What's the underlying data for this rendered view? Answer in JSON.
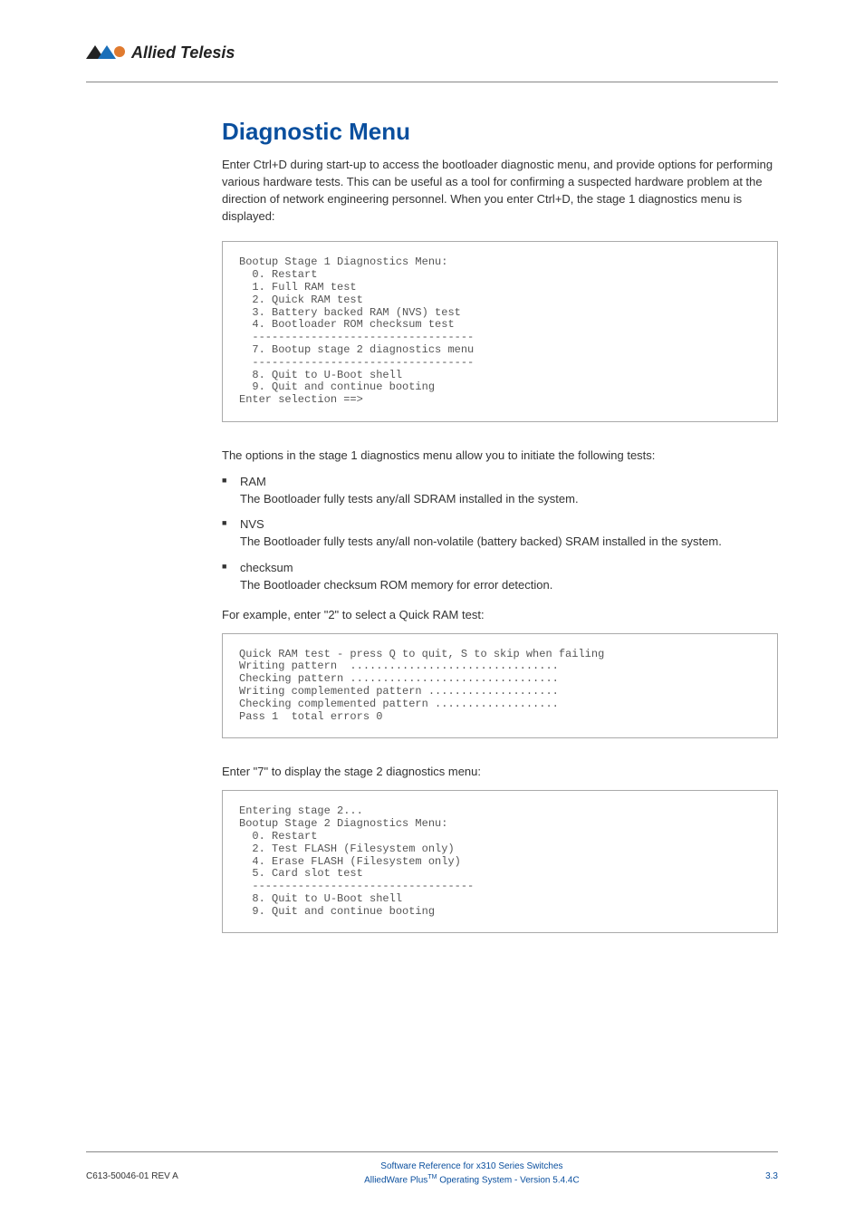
{
  "chart_data": {
    "type": "table",
    "title": "Diagnostic Menu",
    "description": "Bootloader diagnostic menu options and test output",
    "stage1_menu_options": [
      {
        "option": 0,
        "label": "Restart"
      },
      {
        "option": 1,
        "label": "Full RAM test"
      },
      {
        "option": 2,
        "label": "Quick RAM test"
      },
      {
        "option": 3,
        "label": "Battery backed RAM (NVS) test"
      },
      {
        "option": 4,
        "label": "Bootloader ROM checksum test"
      },
      {
        "option": 7,
        "label": "Bootup stage 2 diagnostics menu"
      },
      {
        "option": 8,
        "label": "Quit to U-Boot shell"
      },
      {
        "option": 9,
        "label": "Quit and continue booting"
      }
    ],
    "stage2_menu_options": [
      {
        "option": 0,
        "label": "Restart"
      },
      {
        "option": 2,
        "label": "Test FLASH (Filesystem only)"
      },
      {
        "option": 4,
        "label": "Erase FLASH (Filesystem only)"
      },
      {
        "option": 5,
        "label": "Card slot test"
      },
      {
        "option": 8,
        "label": "Quit to U-Boot shell"
      },
      {
        "option": 9,
        "label": "Quit and continue booting"
      }
    ],
    "quick_ram_test_result": {
      "pass": 1,
      "total_errors": 0
    }
  },
  "header": {
    "logo_text": "Allied Telesis"
  },
  "main": {
    "title": "Diagnostic Menu",
    "intro": "Enter Ctrl+D during start-up to access the bootloader diagnostic menu, and provide options for performing various hardware tests. This can be useful as a tool for confirming a suspected hardware problem at the direction of network engineering personnel. When you enter Ctrl+D, the stage 1 diagnostics menu is displayed:",
    "codebox1": "Bootup Stage 1 Diagnostics Menu:\n  0. Restart\n  1. Full RAM test\n  2. Quick RAM test\n  3. Battery backed RAM (NVS) test\n  4. Bootloader ROM checksum test\n  ----------------------------------\n  7. Bootup stage 2 diagnostics menu\n  ----------------------------------\n  8. Quit to U-Boot shell\n  9. Quit and continue booting\nEnter selection ==>",
    "options_intro": "The options in the stage 1 diagnostics menu allow you to initiate the following tests:",
    "bullets": [
      {
        "term": "RAM",
        "desc": "The Bootloader fully tests any/all SDRAM installed in the system."
      },
      {
        "term": "NVS",
        "desc": "The Bootloader fully tests any/all non-volatile (battery backed) SRAM installed in the system."
      },
      {
        "term": "checksum",
        "desc": "The Bootloader checksum ROM memory for error detection."
      }
    ],
    "example_intro": "For example, enter \"2\" to select a Quick RAM test:",
    "codebox2": "Quick RAM test - press Q to quit, S to skip when failing\nWriting pattern  ................................\nChecking pattern ................................\nWriting complemented pattern ....................\nChecking complemented pattern ...................\nPass 1  total errors 0",
    "stage2_intro": "Enter \"7\" to display the stage 2 diagnostics menu:",
    "codebox3": "Entering stage 2...\nBootup Stage 2 Diagnostics Menu:\n  0. Restart\n  2. Test FLASH (Filesystem only)\n  4. Erase FLASH (Filesystem only)\n  5. Card slot test\n  ----------------------------------\n  8. Quit to U-Boot shell\n  9. Quit and continue booting"
  },
  "footer": {
    "left": "C613-50046-01 REV A",
    "center_line1": "Software Reference for x310 Series Switches",
    "center_line2_a": "AlliedWare Plus",
    "center_line2_b": " Operating System - Version 5.4.4C",
    "right": "3.3"
  }
}
